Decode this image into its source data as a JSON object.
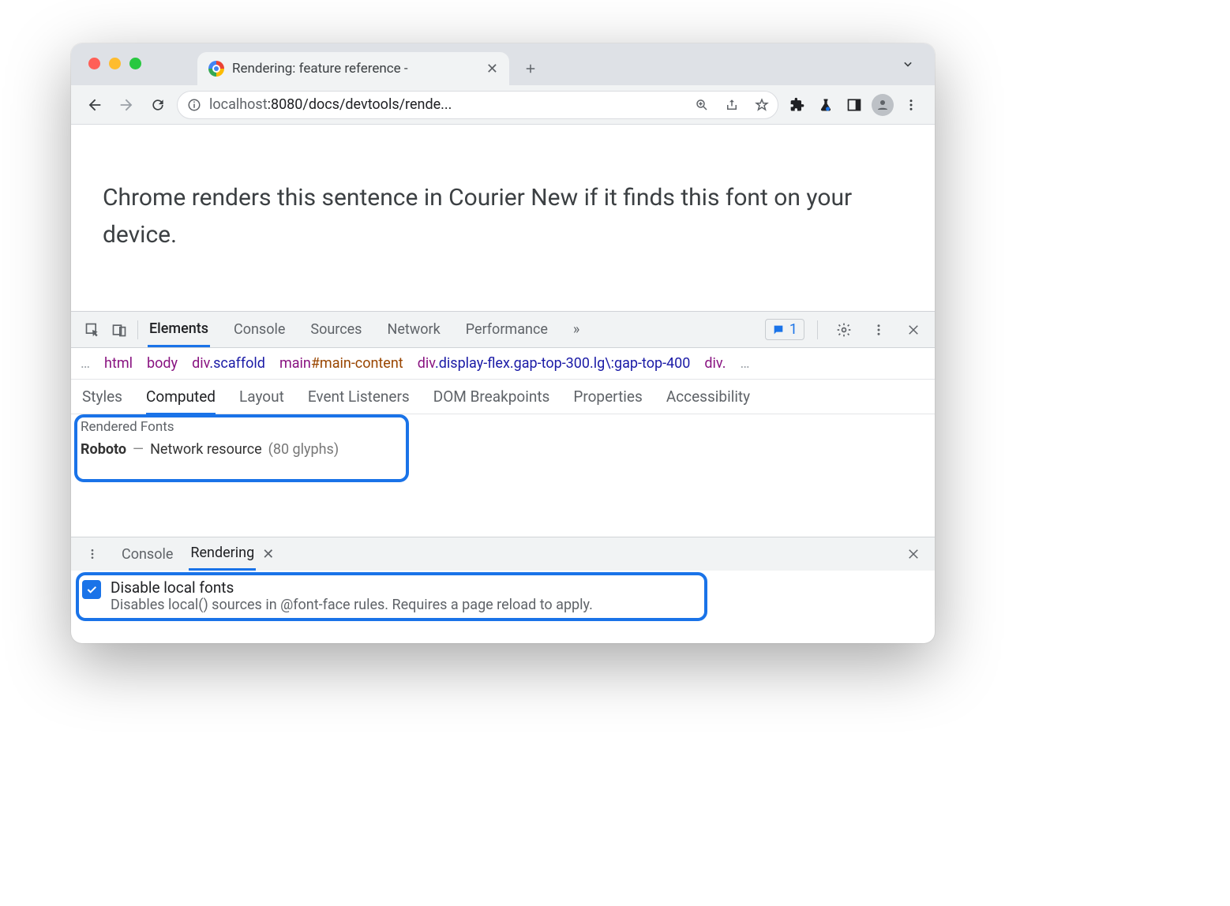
{
  "tab": {
    "title": "Rendering: feature reference -"
  },
  "url": {
    "full": "localhost:8080/docs/devtools/rende...",
    "hostdim": "localhost",
    "rest": ":8080/docs/devtools/rende..."
  },
  "page": {
    "sentence": "Chrome renders this sentence in Courier New if it finds this font on your device."
  },
  "devtools": {
    "tabs": [
      "Elements",
      "Console",
      "Sources",
      "Network",
      "Performance"
    ],
    "active_tab": "Elements",
    "more": "»",
    "issues_count": "1",
    "breadcrumb": [
      {
        "tag": "html"
      },
      {
        "tag": "body"
      },
      {
        "tag": "div",
        "cls": ".scaffold"
      },
      {
        "tag": "main",
        "id": "#main-content"
      },
      {
        "tag": "div",
        "cls": ".display-flex.gap-top-300.lg\\:gap-top-400"
      },
      {
        "tag": "div."
      }
    ],
    "subtabs": [
      "Styles",
      "Computed",
      "Layout",
      "Event Listeners",
      "DOM Breakpoints",
      "Properties",
      "Accessibility"
    ],
    "active_subtab": "Computed",
    "rendered_fonts": {
      "heading": "Rendered Fonts",
      "font": "Roboto",
      "sep": "—",
      "source": "Network resource",
      "glyphs": "(80 glyphs)"
    },
    "drawer": {
      "tabs": [
        "Console",
        "Rendering"
      ],
      "active": "Rendering",
      "option": {
        "title": "Disable local fonts",
        "desc": "Disables local() sources in @font-face rules. Requires a page reload to apply."
      }
    }
  }
}
